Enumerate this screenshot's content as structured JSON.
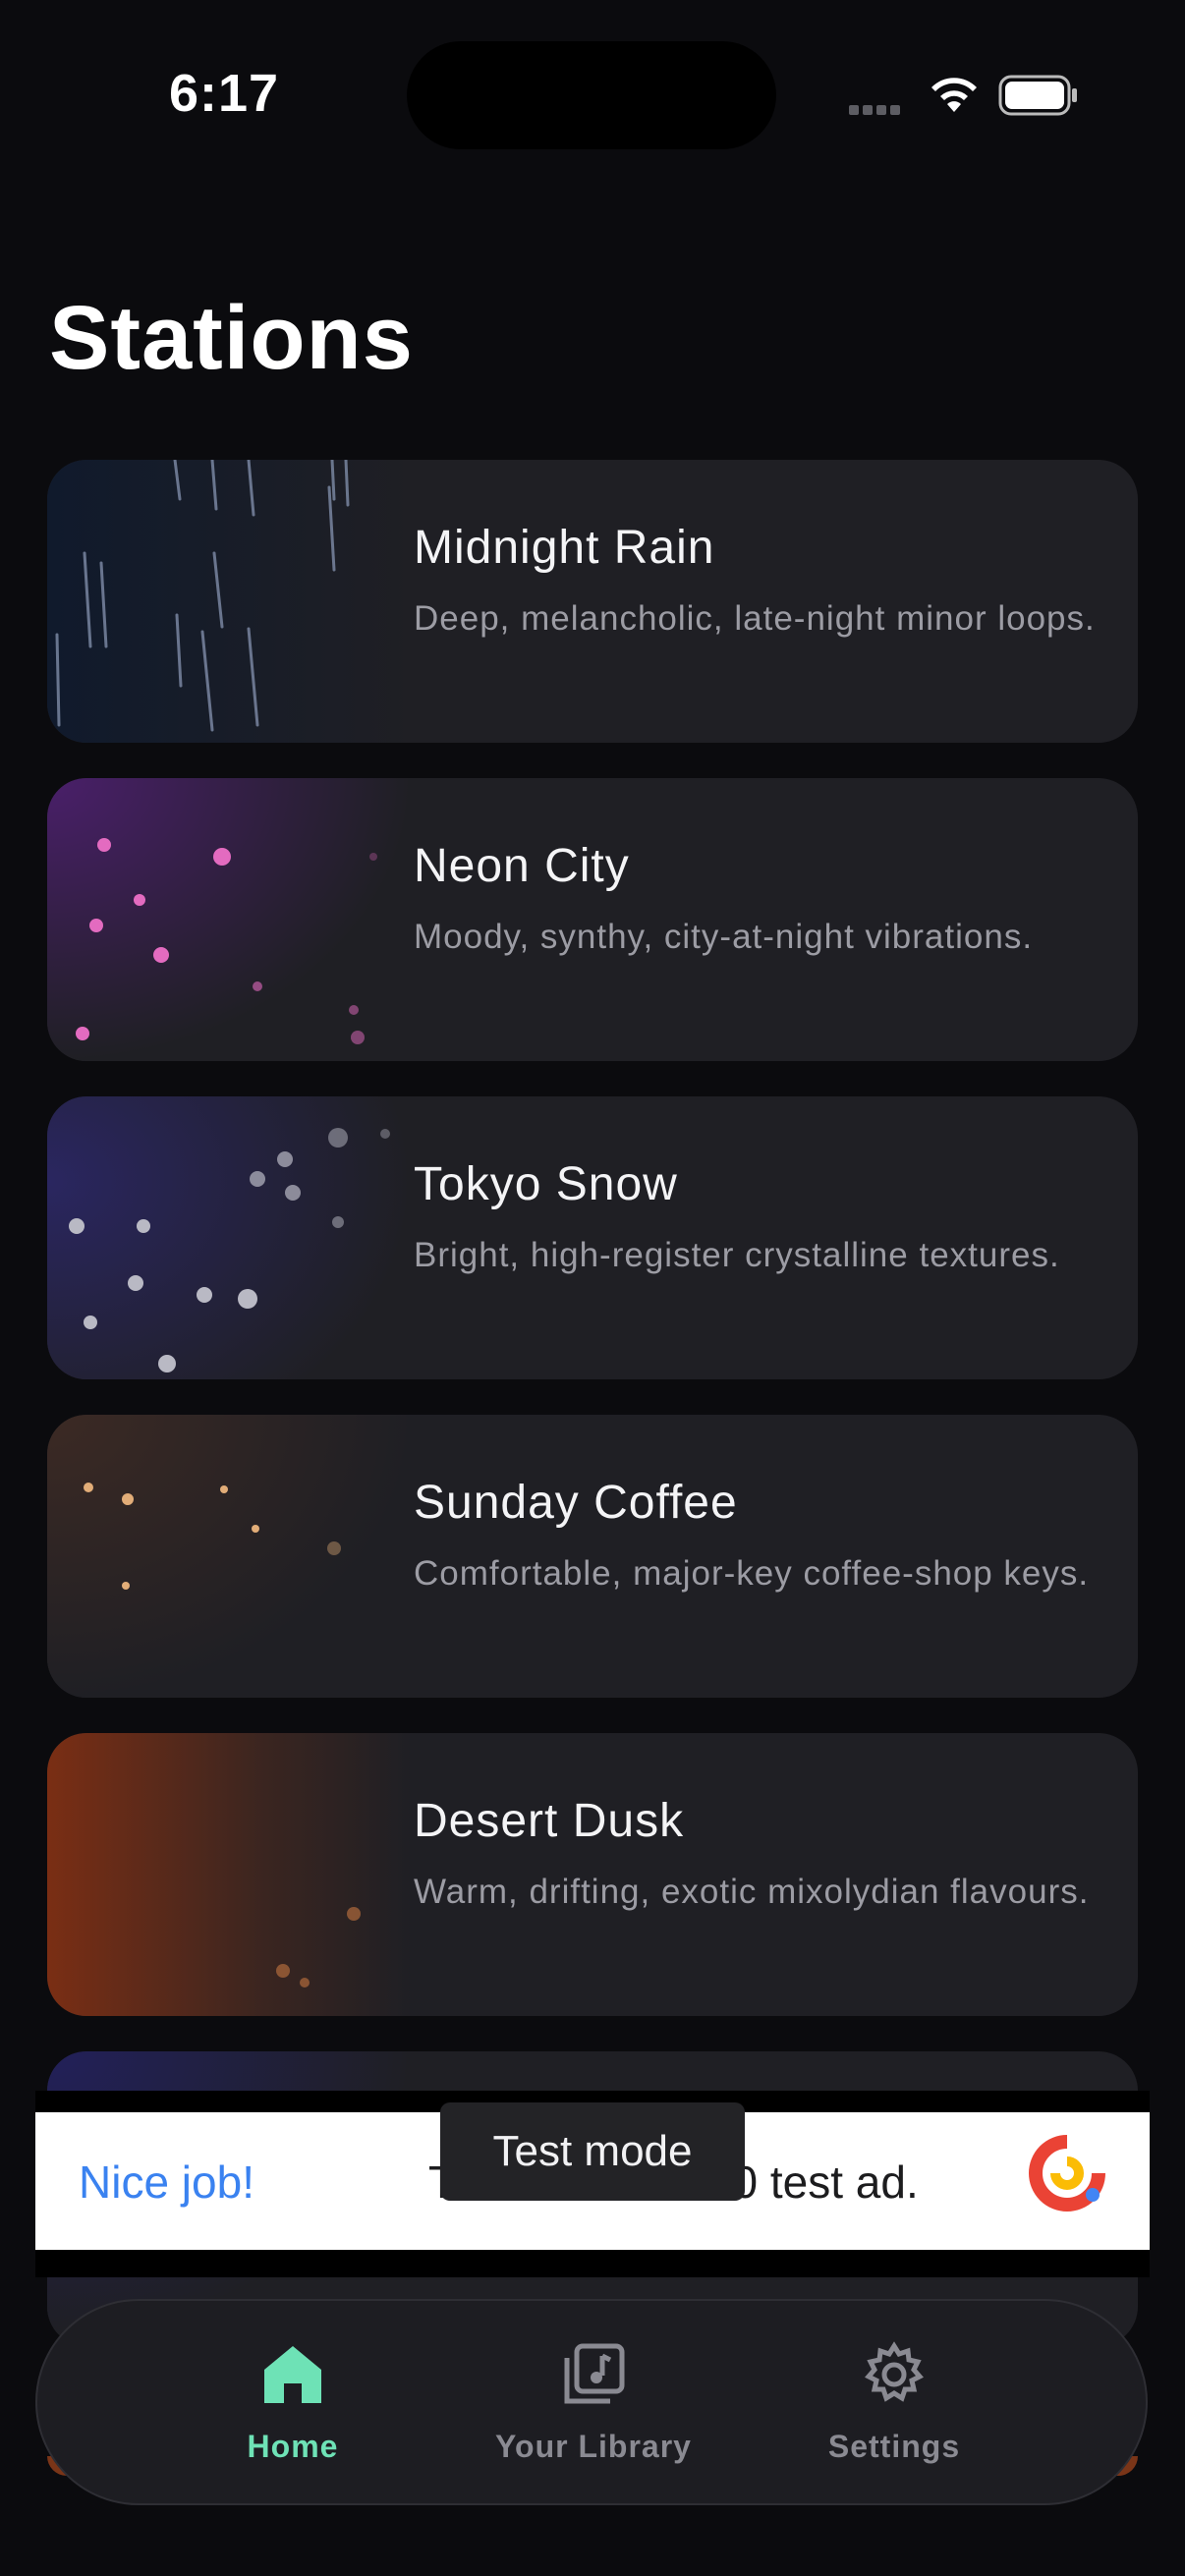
{
  "status_bar": {
    "time": "6:17"
  },
  "page": {
    "title": "Stations"
  },
  "stations": [
    {
      "title": "Midnight Rain",
      "description": "Deep, melancholic, late-night minor loops."
    },
    {
      "title": "Neon City",
      "description": "Moody, synthy, city-at-night vibrations."
    },
    {
      "title": "Tokyo Snow",
      "description": "Bright, high-register crystalline textures."
    },
    {
      "title": "Sunday Coffee",
      "description": "Comfortable, major-key coffee-shop keys."
    },
    {
      "title": "Desert Dusk",
      "description": "Warm, drifting, exotic mixolydian flavours."
    }
  ],
  "ad": {
    "headline": "Nice job!",
    "text": "T           0 test ad.",
    "toast": "Test mode"
  },
  "tabbar": {
    "items": [
      {
        "label": "Home",
        "icon": "home-icon",
        "active": true
      },
      {
        "label": "Your Library",
        "icon": "library-icon",
        "active": false
      },
      {
        "label": "Settings",
        "icon": "gear-icon",
        "active": false
      }
    ]
  },
  "colors": {
    "accent": "#6ee2b6",
    "background": "#0b0b0e",
    "card": "#1f1f24"
  }
}
